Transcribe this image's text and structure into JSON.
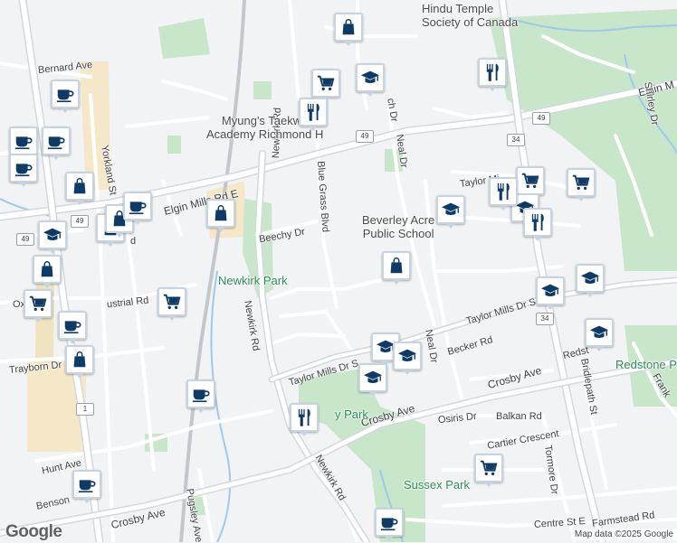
{
  "map": {
    "provider_logo": "Google",
    "attribution": "Map data ©2025 Google"
  },
  "places": [
    {
      "name": "Hindu Temple Society of Canada",
      "lines": [
        "Hindu Temple",
        "Society of Canada"
      ]
    },
    {
      "name": "Myung's Taekwondo Academy Richmond Hill",
      "lines": [
        "Myung's Taekwo",
        "Academy Richmond H"
      ]
    },
    {
      "name": "Beverley Acres Public School",
      "lines": [
        "Beverley Acre",
        "Public School"
      ]
    }
  ],
  "parks": [
    "Newkirk Park",
    "Redstone Park",
    "Sussex Park",
    "y Park"
  ],
  "streets": [
    "Bernard Ave",
    "Elgin Mills Rd E",
    "Elgin M",
    "Shirley Dr",
    "Yorkland St",
    "Newkirk Rd",
    "Blue Grass Blvd",
    "Neal Dr",
    "Ro",
    "ch Dr",
    "Taylor Mi",
    "Taylor Mills Dr S",
    "Beechy Dr",
    "Oxf",
    "ustrial Rd",
    "Trayborn Dr",
    "Becker Rd",
    "Crosby Ave",
    "Redst",
    "Bridlepath St",
    "Frank",
    "Osiris Dr",
    "Balkan Rd",
    "Cartier Crescent",
    "Tormore Dr",
    "Hunt Ave",
    "Benson",
    "Pugsley Ave",
    "Centre St E",
    "Farmstead Rd",
    "d"
  ],
  "route_shields": [
    "49",
    "34",
    "1"
  ],
  "pin_types": {
    "shopping": "shopping-bag-icon",
    "grocery": "shopping-cart-icon",
    "school": "graduation-cap-icon",
    "restaurant": "fork-knife-icon",
    "cafe": "coffee-cup-icon"
  },
  "pin_counts": {
    "shopping": 8,
    "grocery": 6,
    "school": 10,
    "restaurant": 5,
    "cafe": 9
  }
}
